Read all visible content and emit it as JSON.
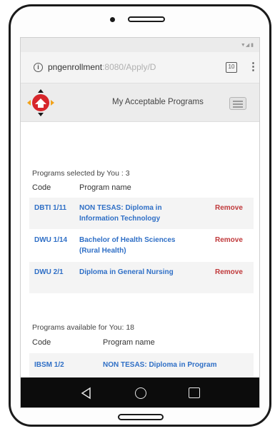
{
  "browser": {
    "url_host": "pngenrollment",
    "url_path": ":8080/Apply/D",
    "tab_count": "10"
  },
  "header": {
    "title": "My Acceptable Programs"
  },
  "selected": {
    "heading": "Programs selected by You : 3",
    "columns": {
      "code": "Code",
      "name": "Program name"
    },
    "rows": [
      {
        "code": "DBTI 1/11",
        "name": "NON TESAS: Diploma in Information Technology",
        "action": "Remove"
      },
      {
        "code": "DWU 1/14",
        "name": "Bachelor of Health Sciences (Rural Health)",
        "action": "Remove"
      },
      {
        "code": "DWU 2/1",
        "name": "Diploma in General Nursing",
        "action": "Remove"
      }
    ]
  },
  "available": {
    "heading": "Programs available for You: 18",
    "columns": {
      "code": "Code",
      "name": "Program name"
    },
    "rows": [
      {
        "code": "IBSM 1/2",
        "name": "NON TESAS: Diploma in Program"
      }
    ]
  },
  "colors": {
    "link": "#2f6fc6",
    "remove": "#c0393b",
    "logo_red": "#d7262b",
    "logo_orange": "#f2a21b"
  }
}
